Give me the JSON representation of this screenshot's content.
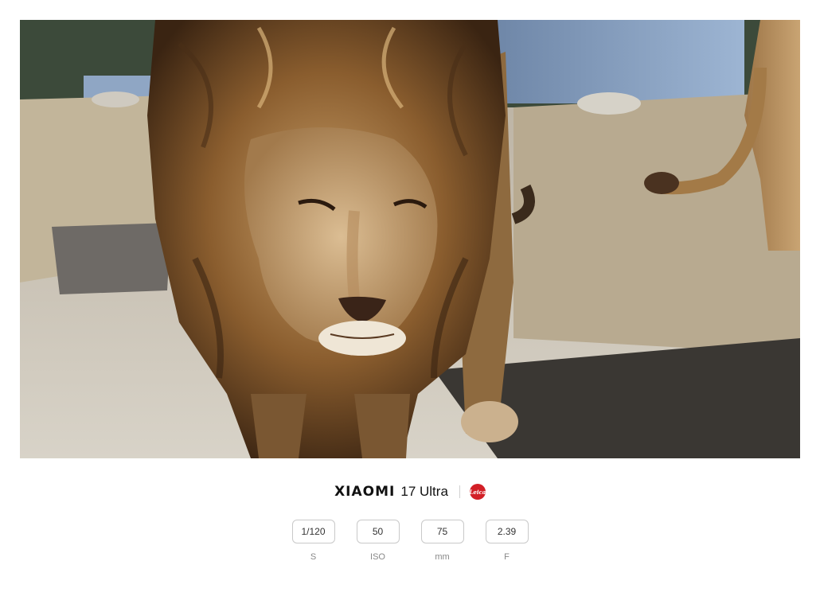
{
  "photo": {
    "subject": "lion-photograph"
  },
  "brand": {
    "name": "XIAOMI",
    "model": "17 Ultra",
    "logo_text": "Leica",
    "logo_color": "#d21f26"
  },
  "params": [
    {
      "value": "1/120",
      "label": "S"
    },
    {
      "value": "50",
      "label": "ISO"
    },
    {
      "value": "75",
      "label": "mm"
    },
    {
      "value": "2.39",
      "label": "F"
    }
  ]
}
